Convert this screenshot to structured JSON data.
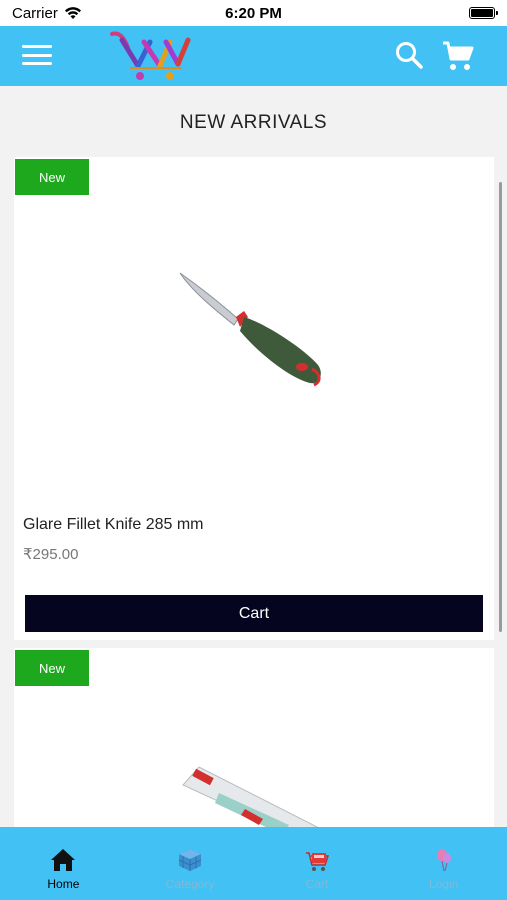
{
  "status_bar": {
    "carrier": "Carrier",
    "time": "6:20 PM"
  },
  "header": {
    "menu_icon": "hamburger-icon",
    "logo_icon": "shopping-cart-logo",
    "search_icon": "search-icon",
    "cart_icon": "shopping-cart-icon",
    "background_color": "#42c1f5"
  },
  "page": {
    "title": "NEW ARRIVALS"
  },
  "products": [
    {
      "badge": "New",
      "name": "Glare Fillet Knife 285 mm",
      "price": "₹295.00",
      "button_label": "Cart"
    },
    {
      "badge": "New"
    }
  ],
  "tabs": [
    {
      "label": "Home",
      "icon": "home-icon",
      "active": true
    },
    {
      "label": "Category",
      "icon": "cube-grid-icon",
      "active": false
    },
    {
      "label": "Cart",
      "icon": "shopping-cart-icon",
      "active": false
    },
    {
      "label": "Login",
      "icon": "balloon-icon",
      "active": false
    }
  ],
  "colors": {
    "badge": "#1ea81e",
    "cart_button": "#05051f",
    "accent": "#42c1f5"
  }
}
